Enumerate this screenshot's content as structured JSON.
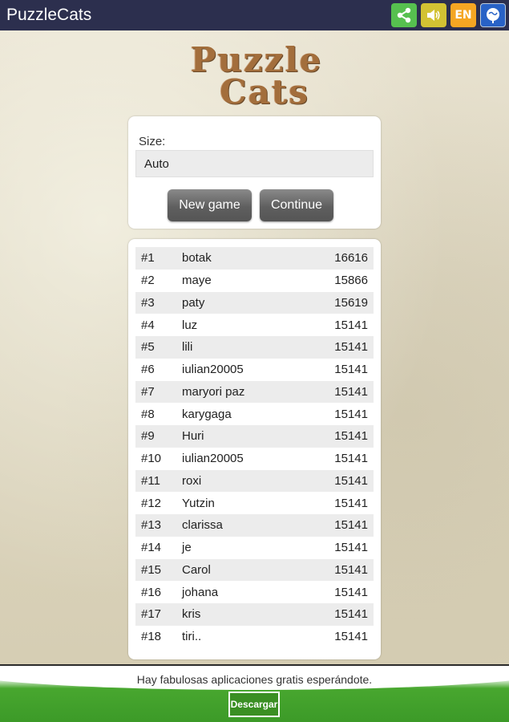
{
  "app": {
    "title": "PuzzleCats",
    "actions": [
      {
        "name": "share-icon"
      },
      {
        "name": "sound-icon"
      },
      {
        "name": "language-icon",
        "label": "EN"
      },
      {
        "name": "web-icon"
      }
    ]
  },
  "logo": {
    "line1": "Puzzle",
    "line2": "Cats"
  },
  "size": {
    "label": "Size:",
    "value": "Auto"
  },
  "buttons": {
    "new_game": "New game",
    "continue": "Continue"
  },
  "scores": [
    {
      "rank": "#1",
      "name": "botak",
      "score": "16616"
    },
    {
      "rank": "#2",
      "name": "maye",
      "score": "15866"
    },
    {
      "rank": "#3",
      "name": "paty",
      "score": "15619"
    },
    {
      "rank": "#4",
      "name": "luz",
      "score": "15141"
    },
    {
      "rank": "#5",
      "name": "lili",
      "score": "15141"
    },
    {
      "rank": "#6",
      "name": "iulian20005",
      "score": "15141"
    },
    {
      "rank": "#7",
      "name": "maryori paz",
      "score": "15141"
    },
    {
      "rank": "#8",
      "name": "karygaga",
      "score": "15141"
    },
    {
      "rank": "#9",
      "name": "Huri",
      "score": "15141"
    },
    {
      "rank": "#10",
      "name": "iulian20005",
      "score": "15141"
    },
    {
      "rank": "#11",
      "name": "roxi",
      "score": "15141"
    },
    {
      "rank": "#12",
      "name": "Yutzin",
      "score": "15141"
    },
    {
      "rank": "#13",
      "name": "clarissa",
      "score": "15141"
    },
    {
      "rank": "#14",
      "name": "je",
      "score": "15141"
    },
    {
      "rank": "#15",
      "name": "Carol",
      "score": "15141"
    },
    {
      "rank": "#16",
      "name": "johana",
      "score": "15141"
    },
    {
      "rank": "#17",
      "name": "kris",
      "score": "15141"
    },
    {
      "rank": "#18",
      "name": "tiri..",
      "score": "15141"
    }
  ],
  "ad": {
    "message": "Hay fabulosas aplicaciones gratis esperándote.",
    "button": "Descargar"
  },
  "colors": {
    "appbar": "#2c2f4e",
    "share": "#56c04f",
    "sound": "#d2c233",
    "language": "#f5a623",
    "web": "#2862c6",
    "ad_green": "#48a72f"
  }
}
